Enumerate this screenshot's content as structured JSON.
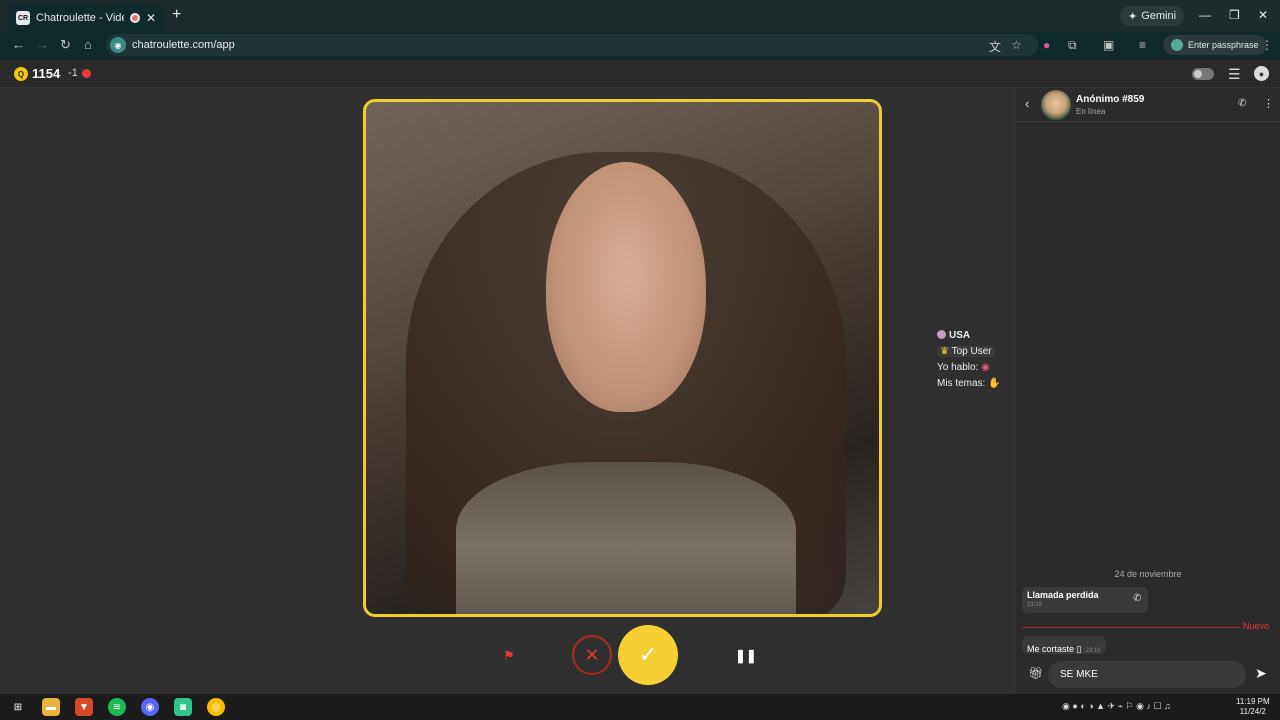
{
  "browser": {
    "tab_title": "Chatroulette - Videochat al",
    "favicon_text": "CR",
    "new_tab": "+",
    "gemini_label": "Gemini",
    "url": "chatroulette.com/app",
    "passphrase_label": "Enter passphrase"
  },
  "appbar": {
    "coin_symbol": "Q",
    "coins": "1154",
    "delta": "-1"
  },
  "partner": {
    "country": "USA",
    "badge": "Top User",
    "speaks": "Yo hablo:",
    "topics": "Mis temas:"
  },
  "chat": {
    "username": "Anónimo #859",
    "status": "En línea",
    "date_separator": "24 de noviembre",
    "missed_call": "Llamada perdida",
    "missed_time": "23:19",
    "new_label": "Nuevo",
    "message": "Me cortaste ▯",
    "message_time": "23:19",
    "input_value": "SE MKE"
  },
  "taskbar": {
    "time": "11:19 PM",
    "date": "11/24/2"
  },
  "colors": {
    "accent_yellow": "#f6cf32",
    "danger_red": "#e53935",
    "panel_bg": "#2b2b2b"
  },
  "icons": [
    "back-icon",
    "forward-icon",
    "reload-icon",
    "home-icon",
    "translate-icon",
    "star-icon",
    "extensions-icon",
    "flag-icon",
    "close-icon",
    "check-icon",
    "pause-icon",
    "phone-icon",
    "more-icon",
    "gift-icon",
    "send-icon",
    "settings-icon",
    "profile-icon"
  ]
}
